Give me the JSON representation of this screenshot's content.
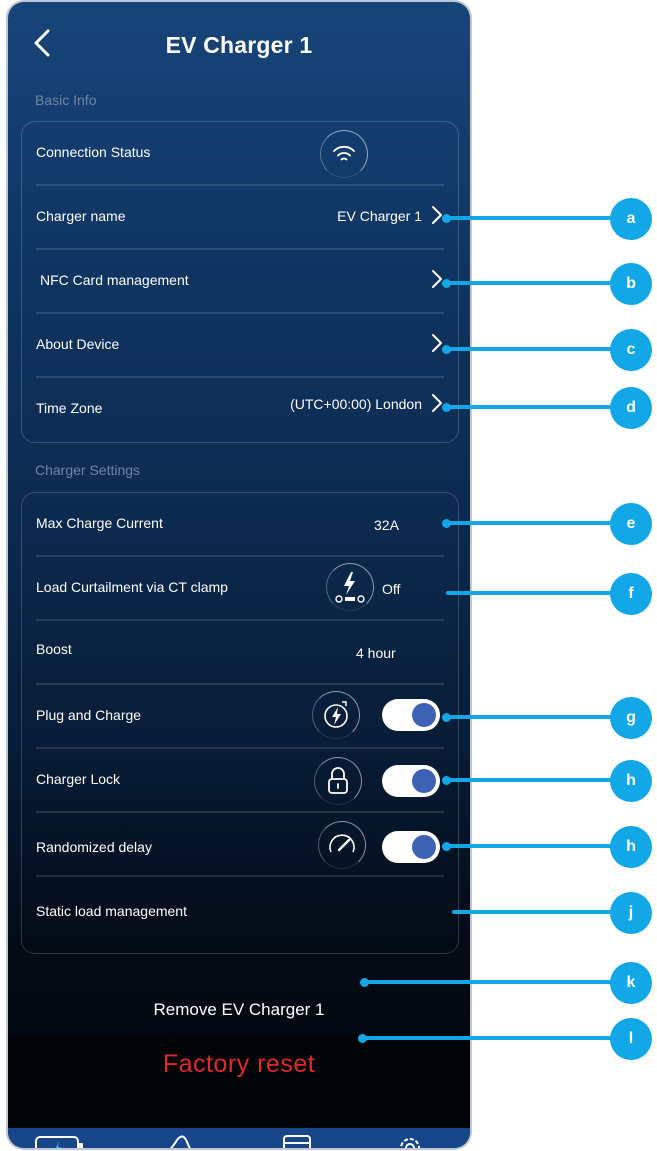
{
  "header": {
    "title": "EV Charger 1"
  },
  "basic_info": {
    "section_label": "Basic Info",
    "connection_status_label": "Connection Status",
    "charger_name_label": "Charger name",
    "charger_name_value": "EV Charger 1",
    "nfc_label": "NFC Card management",
    "about_label": "About Device",
    "time_zone_label": "Time Zone",
    "time_zone_value": "(UTC+00:00) London"
  },
  "charger_settings": {
    "section_label": "Charger Settings",
    "max_current_label": "Max Charge Current",
    "max_current_value": "32A",
    "load_curtailment_label": "Load Curtailment via CT clamp",
    "load_curtailment_value": "Off",
    "boost_label": "Boost",
    "boost_value": "4 hour",
    "plug_and_charge_label": "Plug and Charge",
    "plug_and_charge_on": true,
    "charger_lock_label": "Charger Lock",
    "charger_lock_on": true,
    "randomized_delay_label": "Randomized delay",
    "randomized_delay_on": true,
    "static_load_label": "Static load management"
  },
  "actions": {
    "remove_label": "Remove EV Charger 1",
    "factory_reset_label": "Factory reset"
  },
  "tabbar": {
    "icons": [
      "battery-charging-icon",
      "chart-line-icon",
      "calendar-icon",
      "gear-icon"
    ]
  },
  "callouts": [
    "a",
    "b",
    "c",
    "d",
    "e",
    "f",
    "g",
    "h",
    "h",
    "j",
    "k",
    "l"
  ],
  "colors": {
    "accent": "#12a8e8",
    "toggle_knob": "#3e62b6",
    "danger": "#e02a2a",
    "tabbar": "#18468a"
  }
}
